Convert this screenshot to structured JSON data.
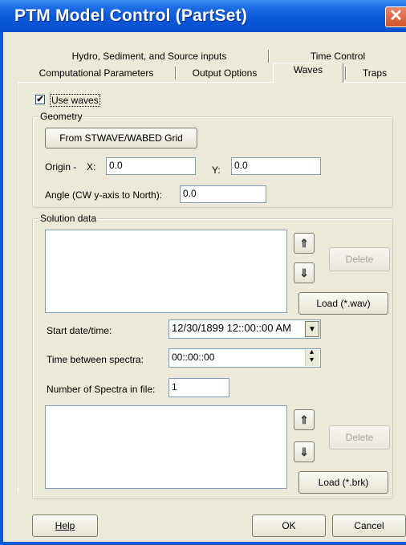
{
  "window": {
    "title": "PTM Model Control (PartSet)",
    "close_glyph": "✕"
  },
  "tabs": {
    "row1": [
      "Hydro, Sediment, and Source inputs",
      "Time Control"
    ],
    "row2": [
      "Computational Parameters",
      "Output Options",
      "Waves",
      "Traps"
    ],
    "active": "Waves"
  },
  "use_waves": {
    "label": "Use waves",
    "checked": true,
    "check_glyph": "✔"
  },
  "geometry": {
    "legend": "Geometry",
    "from_grid_button": "From STWAVE/WABED Grid",
    "origin_label": "Origin -",
    "x_label": "X:",
    "x_value": "0.0",
    "y_label": "Y:",
    "y_value": "0.0",
    "angle_label": "Angle (CW y-axis to North):",
    "angle_value": "0.0"
  },
  "solution": {
    "legend": "Solution data",
    "up_icon": "⇑",
    "down_icon": "⇓",
    "delete_button": "Delete",
    "load_wav_button": "Load (*.wav)",
    "start_label": "Start date/time:",
    "start_value": "12/30/1899 12::00::00 AM",
    "dropdown_glyph": "▼",
    "between_label": "Time between spectra:",
    "between_value": "00::00::00",
    "spin_up": "▴",
    "spin_down": "▾",
    "nspectra_label": "Number of Spectra in file:",
    "nspectra_value": "1",
    "delete_button2": "Delete",
    "load_brk_button": "Load (*.brk)"
  },
  "footer": {
    "help": "Help",
    "ok": "OK",
    "cancel": "Cancel"
  }
}
